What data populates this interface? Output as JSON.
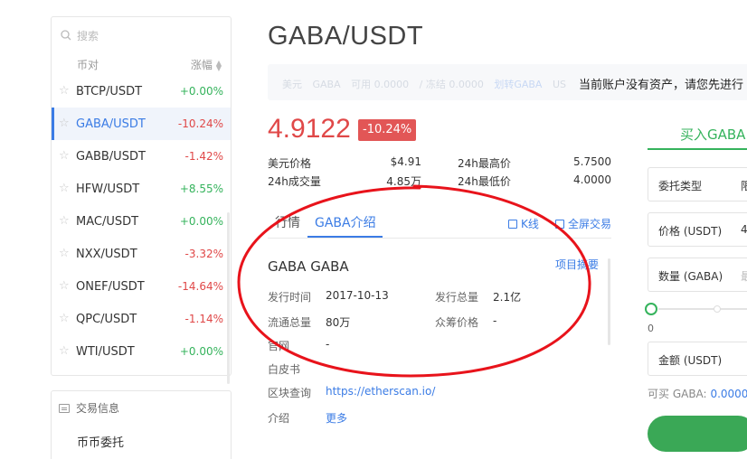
{
  "sidebar": {
    "search_placeholder": "搜索",
    "col_pair": "币对",
    "col_change": "涨幅",
    "pairs": [
      {
        "name": "BTCP/USDT",
        "change": "+0.00%",
        "dir": "up"
      },
      {
        "name": "GABA/USDT",
        "change": "-10.24%",
        "dir": "down",
        "active": true
      },
      {
        "name": "GABB/USDT",
        "change": "-1.42%",
        "dir": "down"
      },
      {
        "name": "HFW/USDT",
        "change": "+8.55%",
        "dir": "up"
      },
      {
        "name": "MAC/USDT",
        "change": "+0.00%",
        "dir": "up"
      },
      {
        "name": "NXX/USDT",
        "change": "-3.32%",
        "dir": "down"
      },
      {
        "name": "ONEF/USDT",
        "change": "-14.64%",
        "dir": "down"
      },
      {
        "name": "QPC/USDT",
        "change": "-1.14%",
        "dir": "down"
      },
      {
        "name": "WTI/USDT",
        "change": "+0.00%",
        "dir": "up"
      }
    ],
    "info_title": "交易信息",
    "info_item": "币币委托"
  },
  "header": {
    "pair_title": "GABA/USDT"
  },
  "assets": {
    "faded_1": "美元",
    "faded_2": "GABA",
    "faded_3": "可用 0.0000",
    "faded_4": "/ 冻结 0.0000",
    "faded_5": "划转GABA",
    "faded_6": "US",
    "notice": "当前账户没有资产，请您先进行"
  },
  "ticker": {
    "price": "4.9122",
    "change_badge": "-10.24%",
    "usd_price_label": "美元价格",
    "usd_price": "$4.91",
    "high_label": "24h最高价",
    "high": "5.7500",
    "volume_label": "24h成交量",
    "volume": "4.85万",
    "low_label": "24h最低价",
    "low": "4.0000"
  },
  "tabs": {
    "market": "行情",
    "intro": "GABA介绍",
    "kline": "K线",
    "fullscreen": "全屏交易"
  },
  "intro": {
    "name": "GABA GABA",
    "summary_link": "项目摘要",
    "issue_date_label": "发行时间",
    "issue_date": "2017-10-13",
    "total_supply_label": "发行总量",
    "total_supply": "2.1亿",
    "circulating_label": "流通总量",
    "circulating": "80万",
    "ico_price_label": "众筹价格",
    "ico_price": "-",
    "website_label": "官网",
    "website": "-",
    "whitepaper_label": "白皮书",
    "explorer_label": "区块查询",
    "explorer": "https://etherscan.io/",
    "description_label": "介绍",
    "more": "更多"
  },
  "order": {
    "buy_tab": "买入GABA",
    "type_label": "委托类型",
    "type_value": "限",
    "price_label": "价格 (USDT)",
    "price_value": "4",
    "amount_label": "数量 (GABA)",
    "amount_placeholder": "最",
    "slider_zero": "0",
    "slider_percent": 0,
    "total_label": "金额 (USDT)",
    "available_label": "可买 GABA:",
    "available_value": "0.0000"
  },
  "colors": {
    "up": "#35b35c",
    "down": "#e04848",
    "accent": "#3b7ce5",
    "annotation": "#e8131b"
  }
}
